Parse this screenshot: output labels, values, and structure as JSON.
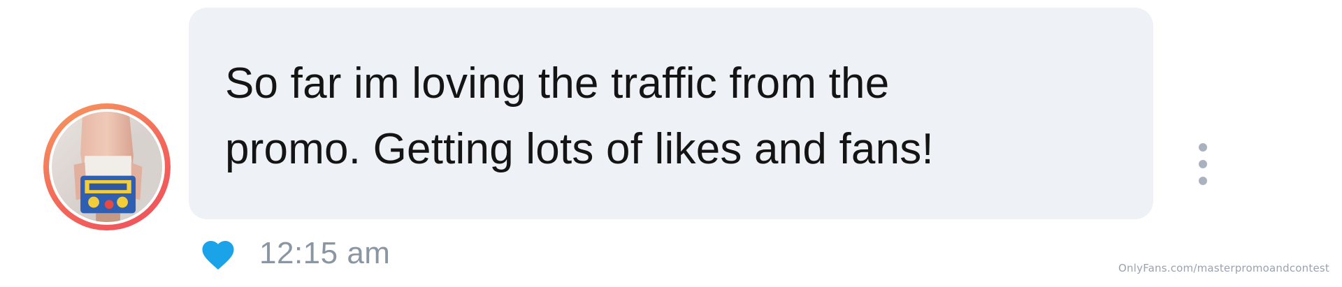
{
  "message": {
    "text": "So far im loving the traffic from the\npromo. Getting lots of likes and fans!",
    "timestamp": "12:15 am",
    "liked": true
  },
  "avatar": {
    "ring_color_start": "#f79a5e",
    "ring_color_end": "#ee4f5c"
  },
  "icons": {
    "heart": "heart-icon",
    "more": "more-vertical-icon"
  },
  "colors": {
    "bubble_background": "#eef2f6",
    "heart": "#1aa3e8",
    "timestamp": "#8a96a3",
    "more_dots": "#a9b2be"
  },
  "watermark": "OnlyFans.com/masterpromoandcontest"
}
